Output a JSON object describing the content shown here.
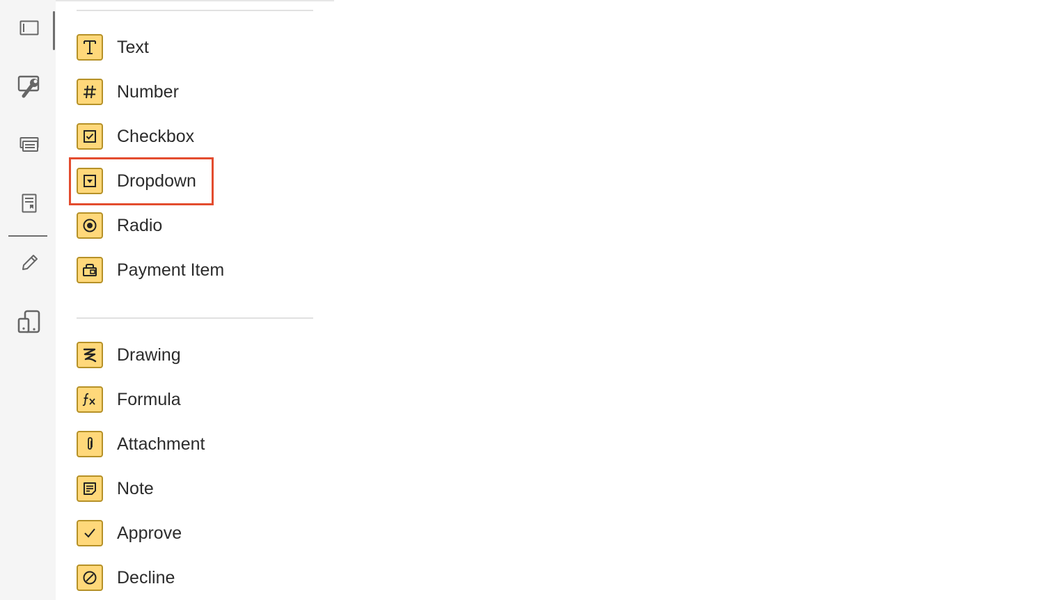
{
  "rail": {
    "items": [
      {
        "icon": "panel-icon",
        "active": true
      },
      {
        "icon": "tools-icon"
      },
      {
        "icon": "forms-icon"
      },
      {
        "icon": "document-icon"
      },
      {
        "icon": "pencil-icon"
      },
      {
        "icon": "devices-icon"
      }
    ]
  },
  "fields": {
    "group1": [
      {
        "label": "Text",
        "icon": "text-icon"
      },
      {
        "label": "Number",
        "icon": "hash-icon"
      },
      {
        "label": "Checkbox",
        "icon": "checkbox-icon"
      },
      {
        "label": "Dropdown",
        "icon": "dropdown-icon",
        "highlighted": true
      },
      {
        "label": "Radio",
        "icon": "radio-icon"
      },
      {
        "label": "Payment Item",
        "icon": "payment-icon"
      }
    ],
    "group2": [
      {
        "label": "Drawing",
        "icon": "drawing-icon"
      },
      {
        "label": "Formula",
        "icon": "formula-icon"
      },
      {
        "label": "Attachment",
        "icon": "paperclip-icon"
      },
      {
        "label": "Note",
        "icon": "note-icon"
      },
      {
        "label": "Approve",
        "icon": "check-icon"
      },
      {
        "label": "Decline",
        "icon": "decline-icon"
      }
    ]
  },
  "colors": {
    "field_icon_fill": "#ffd87a",
    "field_icon_border": "#b69127",
    "highlight": "#e34c2f",
    "rail_background": "#f5f5f5"
  }
}
